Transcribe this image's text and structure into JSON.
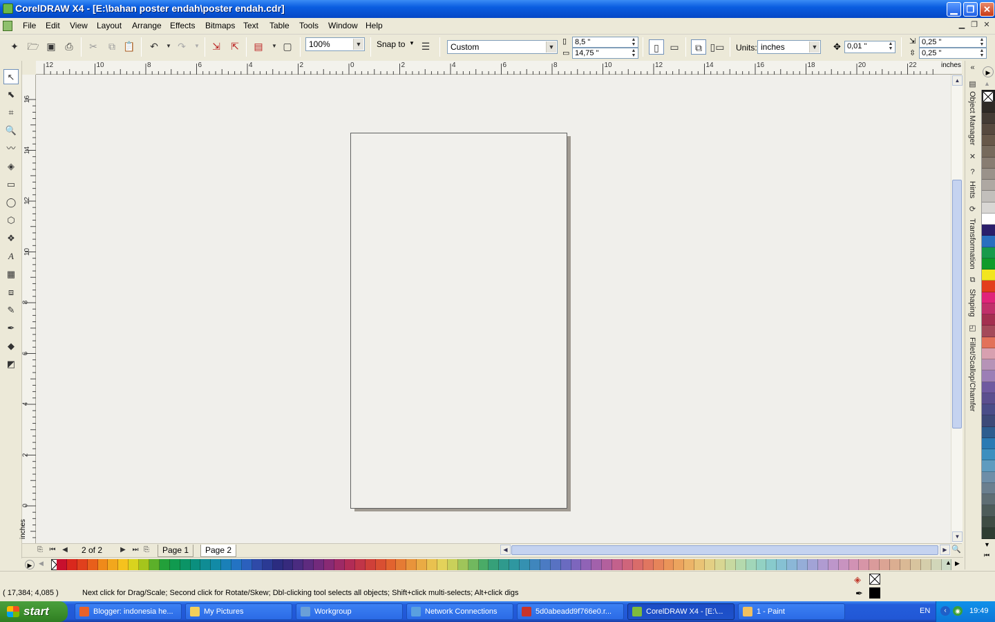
{
  "window": {
    "title": "CorelDRAW X4 - [E:\\bahan poster endah\\poster endah.cdr]",
    "minimize": "▁",
    "restore": "❐",
    "close": "✕"
  },
  "menu": {
    "items": [
      "File",
      "Edit",
      "View",
      "Layout",
      "Arrange",
      "Effects",
      "Bitmaps",
      "Text",
      "Table",
      "Tools",
      "Window",
      "Help"
    ]
  },
  "toolbar": {
    "zoom": "100%",
    "snap_to": "Snap to",
    "paper_type": "Custom",
    "width": "8,5 \"",
    "height": "14,75 \"",
    "units_label": "Units:",
    "units": "inches",
    "nudge": "0,01 \"",
    "dup_x": "0,25 \"",
    "dup_y": "0,25 \""
  },
  "ruler": {
    "top_labels": [
      "12",
      "10",
      "8",
      "6",
      "4",
      "2",
      "0",
      "2",
      "4",
      "6",
      "8",
      "10",
      "12",
      "14",
      "16",
      "18",
      "20",
      "22"
    ],
    "top_unit": "inches",
    "left_labels": [
      "16",
      "14",
      "12",
      "10",
      "8",
      "6",
      "4",
      "2",
      "0"
    ],
    "left_unit": "inches"
  },
  "pages": {
    "counter": "2 of 2",
    "tabs": [
      "Page 1",
      "Page 2"
    ],
    "active": "Page 2"
  },
  "dockers": [
    "Object Manager",
    "Hints",
    "Transformation",
    "Shaping",
    "Fillet/Scallop/Chamfer"
  ],
  "status": {
    "coordinates": "( 17,384; 4,085 )",
    "hint": "Next click for Drag/Scale; Second click for Rotate/Skew; Dbl-clicking tool selects all objects; Shift+click multi-selects; Alt+click digs"
  },
  "palette_colors": [
    "#c8102e",
    "#d9281d",
    "#e0401d",
    "#e85f1b",
    "#ef8a1a",
    "#f2a71d",
    "#f5c21e",
    "#d9d31e",
    "#a5c51c",
    "#5cb02a",
    "#23a03a",
    "#109a4f",
    "#0b9466",
    "#0b8f7e",
    "#0f8c94",
    "#128aa6",
    "#1a80b8",
    "#2373c3",
    "#2b60bd",
    "#2f4aa8",
    "#2b3a94",
    "#2b2c80",
    "#362a7d",
    "#4a2b80",
    "#5e2b7f",
    "#732a7c",
    "#892a74",
    "#9e2a66",
    "#b22c56",
    "#c13548",
    "#cf4039",
    "#d94f32",
    "#e2632f",
    "#e57b34",
    "#e8943b",
    "#eaab44",
    "#e9c14f",
    "#e3d25a",
    "#c9d05a",
    "#9fc55a",
    "#71b85f",
    "#4aab67",
    "#36a079",
    "#2f9a8d",
    "#2f97a0",
    "#3591b1",
    "#3f86bd",
    "#4b7bc3",
    "#5872c2",
    "#6a6bc0",
    "#7d66bd",
    "#9063b6",
    "#a261ab",
    "#b3609d",
    "#c3618c",
    "#cf657b",
    "#d96c6a",
    "#e07660",
    "#e6845a",
    "#ea9459",
    "#eca45e",
    "#ecb468",
    "#e9c375",
    "#e3cf84",
    "#d8d692",
    "#c7d9a0",
    "#b4d9ad",
    "#a1d6b9",
    "#92d1c3",
    "#88cacc",
    "#86c1d3",
    "#8bb7d7",
    "#95add8",
    "#a2a3d6",
    "#b09bd1",
    "#bd96ca",
    "#c893c0",
    "#d192b4",
    "#d795a7",
    "#da9b9b",
    "#dba494",
    "#dbae91",
    "#dab995",
    "#d8c49e",
    "#d5ceab",
    "#d1d6b9",
    "#cddbc6"
  ],
  "vpalette_colors": [
    "#1a1a1a",
    "#2e2a26",
    "#433b34",
    "#56493e",
    "#675849",
    "#766a5c",
    "#887d72",
    "#9a928a",
    "#aea8a2",
    "#c2bfbb",
    "#d9d7d4",
    "#ffffff",
    "#2b1f6b",
    "#2a6fbf",
    "#179a4a",
    "#0f9b2a",
    "#f2e51f",
    "#e33d1c",
    "#e0247a",
    "#c0306a",
    "#a33050",
    "#a44a5a",
    "#e2725a",
    "#d8a0b0",
    "#b693b7",
    "#9c7fb6",
    "#6f5aa0",
    "#5b4f8f",
    "#4a4d88",
    "#3d4a78",
    "#2d5d8f",
    "#2a7ab3",
    "#3d8fbf",
    "#5f9bbf",
    "#6e8ea8",
    "#6b7f8f",
    "#5f6e74",
    "#4e5c5a",
    "#3f4c44",
    "#2f3d33"
  ],
  "taskbar": {
    "start": "start",
    "tasks": [
      {
        "label": "Blogger: indonesia he...",
        "color": "#e8622a"
      },
      {
        "label": "My Pictures",
        "color": "#f3cf5a"
      },
      {
        "label": "Workgroup",
        "color": "#6aa0d8"
      },
      {
        "label": "Network Connections",
        "color": "#5aa0e0"
      },
      {
        "label": "5d0abeadd9f766e0.r...",
        "color": "#c8342a"
      },
      {
        "label": "CorelDRAW X4 - [E:\\...",
        "color": "#7fba3c"
      },
      {
        "label": "1 - Paint",
        "color": "#f0c060"
      }
    ],
    "active_task": 5,
    "language": "EN",
    "clock": "19:49"
  }
}
